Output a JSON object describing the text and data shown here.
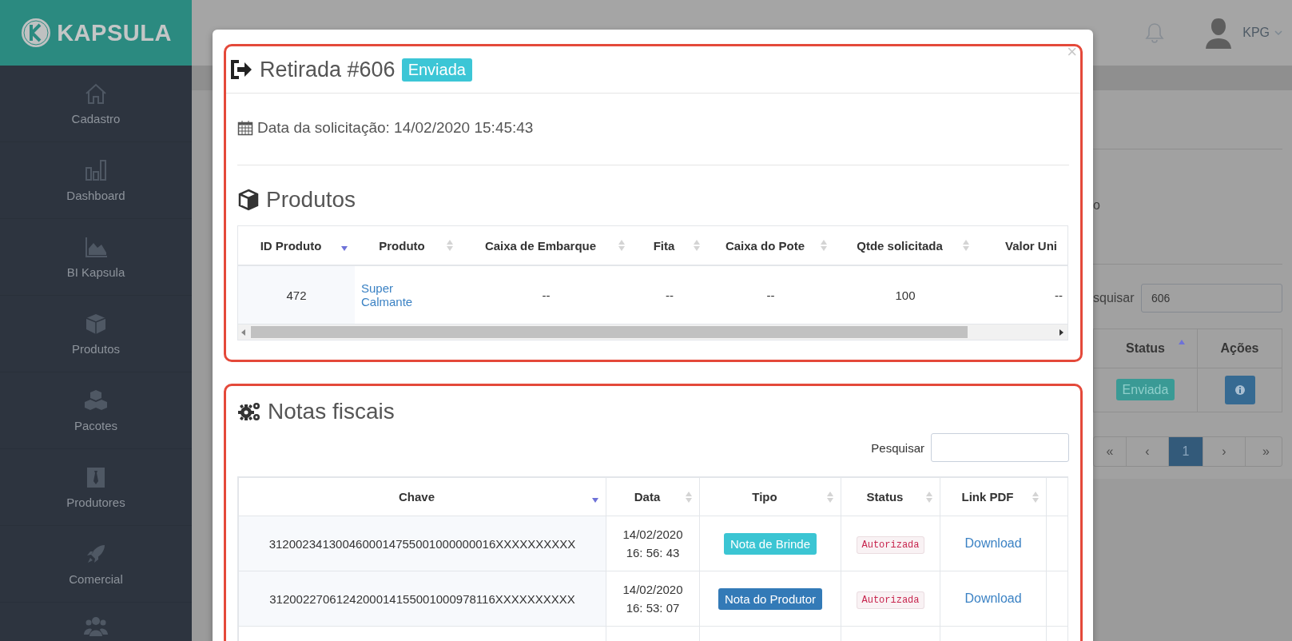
{
  "sidebar": {
    "logo": "KAPSULA",
    "items": [
      {
        "label": "Cadastro",
        "kind": "labeled"
      },
      {
        "label": "Dashboard",
        "kind": "labeled"
      },
      {
        "label": "BI Kapsula",
        "kind": "labeled"
      },
      {
        "label": "Produtos",
        "kind": "labeled"
      },
      {
        "label": "Pacotes",
        "kind": "labeled"
      },
      {
        "label": "Produtores",
        "kind": "labeled"
      },
      {
        "label": "Comercial",
        "kind": "labeled"
      },
      {
        "kind": "icon-only"
      }
    ]
  },
  "topbar": {
    "user": "KPG"
  },
  "page": {
    "text_fragment": "o",
    "search": {
      "label": "squisar",
      "value": "606"
    },
    "table": {
      "columns": [
        {
          "label": "Status",
          "kind": "sorted-asc"
        },
        {
          "label": "Ações",
          "kind": "plain"
        }
      ],
      "rows": [
        {
          "status": "Enviada"
        }
      ]
    },
    "pagination": [
      {
        "label": "«",
        "selected": false
      },
      {
        "label": "‹",
        "selected": false
      },
      {
        "label": "1",
        "selected": true
      },
      {
        "label": "›",
        "selected": false
      },
      {
        "label": "»",
        "selected": false
      }
    ]
  },
  "modal": {
    "title": "Retirada #606",
    "status_badge": "Enviada",
    "close": "×",
    "date_line": "Data da solicitação: 14/02/2020 15:45:43",
    "products": {
      "heading": "Produtos",
      "columns": [
        {
          "label": "ID Produto",
          "kind": "sorted-desc"
        },
        {
          "label": "Produto",
          "kind": "unsorted"
        },
        {
          "label": "Caixa de Embarque",
          "kind": "unsorted"
        },
        {
          "label": "Fita",
          "kind": "unsorted"
        },
        {
          "label": "Caixa do Pote",
          "kind": "unsorted"
        },
        {
          "label": "Qtde solicitada",
          "kind": "unsorted"
        },
        {
          "label": "Valor Uni",
          "kind": "plain"
        }
      ],
      "rows": [
        {
          "cells": [
            "472",
            "Super Calmante",
            "--",
            "--",
            "--",
            "100",
            "--"
          ]
        }
      ]
    },
    "invoices": {
      "heading": "Notas fiscais",
      "search_label": "Pesquisar",
      "columns": [
        {
          "label": "Chave",
          "kind": "sorted-desc"
        },
        {
          "label": "Data",
          "kind": "unsorted"
        },
        {
          "label": "Tipo",
          "kind": "unsorted"
        },
        {
          "label": "Status",
          "kind": "unsorted"
        },
        {
          "label": "Link PDF",
          "kind": "unsorted"
        }
      ],
      "rows": [
        {
          "key": "3120023413004600014755001000000016XXXXXXXXXX",
          "date": "14/02/2020 16: 56: 43",
          "type": {
            "label": "Nota de Brinde",
            "kind": "info"
          },
          "status": "Autorizada",
          "link": "Download"
        },
        {
          "key": "3120022706124200014155001000978116XXXXXXXXXX",
          "date": "14/02/2020 16: 53: 07",
          "type": {
            "label": "Nota do Produtor",
            "kind": "primary"
          },
          "status": "Autorizada",
          "link": "Download"
        }
      ]
    }
  }
}
